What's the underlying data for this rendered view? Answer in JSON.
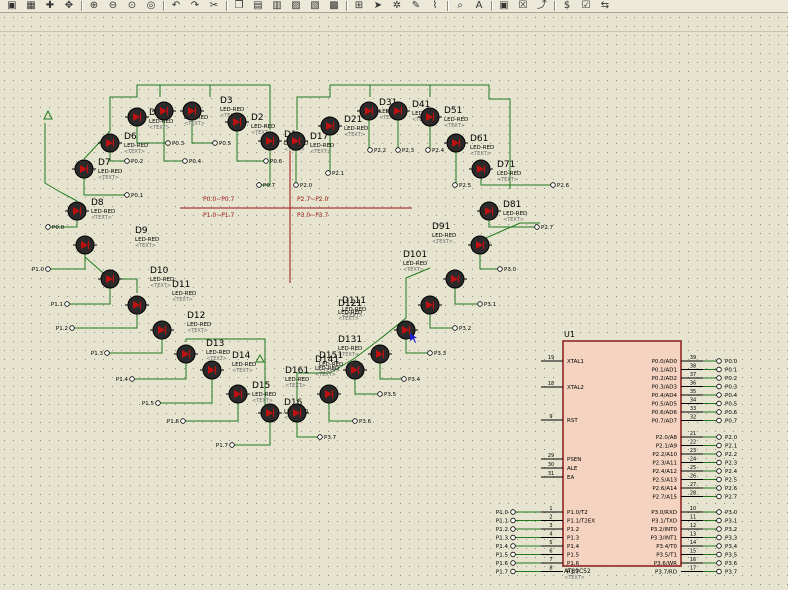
{
  "toolbar": {
    "buttons": [
      {
        "name": "component-mode-icon",
        "glyph": "▣"
      },
      {
        "name": "grid-icon",
        "glyph": "▦"
      },
      {
        "name": "origin-icon",
        "glyph": "✚"
      },
      {
        "name": "pan-icon",
        "glyph": "✥"
      },
      {
        "name": "zoom-in-icon",
        "glyph": "⊕"
      },
      {
        "name": "zoom-out-icon",
        "glyph": "⊖"
      },
      {
        "name": "zoom-all-icon",
        "glyph": "⊙"
      },
      {
        "name": "zoom-area-icon",
        "glyph": "◎"
      },
      {
        "name": "undo-icon",
        "glyph": "↶"
      },
      {
        "name": "redo-icon",
        "glyph": "↷"
      },
      {
        "name": "cut-icon",
        "glyph": "✂"
      },
      {
        "name": "copy-icon",
        "glyph": "❐"
      },
      {
        "name": "paste-icon",
        "glyph": "▤"
      },
      {
        "name": "block-copy-icon",
        "glyph": "▥"
      },
      {
        "name": "block-move-icon",
        "glyph": "▨"
      },
      {
        "name": "block-rotate-icon",
        "glyph": "▧"
      },
      {
        "name": "block-delete-icon",
        "glyph": "▩"
      },
      {
        "name": "pick-device-icon",
        "glyph": "⊞"
      },
      {
        "name": "make-device-icon",
        "glyph": "➤"
      },
      {
        "name": "package-tool-icon",
        "glyph": "✲"
      },
      {
        "name": "decompose-icon",
        "glyph": "✎"
      },
      {
        "name": "wire-autorouter-icon",
        "glyph": "⌇"
      },
      {
        "name": "search-tag-icon",
        "glyph": "⌕"
      },
      {
        "name": "property-tool-icon",
        "glyph": "A"
      },
      {
        "name": "new-sheet-icon",
        "glyph": "▣"
      },
      {
        "name": "remove-sheet-icon",
        "glyph": "☒"
      },
      {
        "name": "exit-to-parent-icon",
        "glyph": "⤴"
      },
      {
        "name": "bom-icon",
        "glyph": "$"
      },
      {
        "name": "erc-icon",
        "glyph": "☑"
      },
      {
        "name": "netlist-icon",
        "glyph": "⇆"
      }
    ]
  },
  "net_labels": {
    "p0": [
      "P0.0",
      "P0.1",
      "P0.2",
      "P0.3",
      "P0.4",
      "P0.5",
      "P0.6",
      "P0.7"
    ],
    "p1": [
      "P1.0",
      "P1.1",
      "P1.2",
      "P1.3",
      "P1.4",
      "P1.5",
      "P1.6",
      "P1.7"
    ],
    "p2": [
      "P2.0",
      "P2.1",
      "P2.2",
      "P2.3",
      "P2.4",
      "P2.5",
      "P2.6",
      "P2.7"
    ],
    "p3": [
      "P3.0",
      "P3.1",
      "P3.2",
      "P3.3",
      "P3.4",
      "P3.5",
      "P3.6",
      "P3.7"
    ]
  },
  "leds": {
    "part_value": "LED-RED",
    "text_placeholder": "<TEXT>",
    "refs": {
      "tl": [
        "D8",
        "D7",
        "D6",
        "D5",
        "D4",
        "D3",
        "D2",
        "D1"
      ],
      "bl": [
        "D9",
        "D10",
        "D11",
        "D12",
        "D13",
        "D14",
        "D15",
        "D16"
      ],
      "tr": [
        "D17",
        "D21",
        "D31",
        "D41",
        "D51",
        "D61",
        "D71",
        "D81"
      ],
      "br": [
        "D91",
        "D101",
        "D111",
        "D121",
        "D131",
        "D141",
        "D151",
        "D161"
      ]
    }
  },
  "quadrant_labels": {
    "tl": "P0.0~P0.7",
    "tr": "P2.7~P2.0",
    "bl": "P1.0~P1.7",
    "br": "P3.0~P3.7"
  },
  "chip": {
    "ref": "U1",
    "part": "AT89C52",
    "text_placeholder": "<TEXT>",
    "left_pins": [
      {
        "num": "19",
        "name": "XTAL1"
      },
      {
        "num": "18",
        "name": "XTAL2"
      },
      {
        "num": "9",
        "name": "RST"
      },
      {
        "num": "29",
        "name": "PSEN"
      },
      {
        "num": "30",
        "name": "ALE"
      },
      {
        "num": "31",
        "name": "EA"
      }
    ],
    "p1_pins": [
      {
        "num": "1",
        "name": "P1.0/T2",
        "net": "P1.0"
      },
      {
        "num": "2",
        "name": "P1.1/T2EX",
        "net": "P1.1"
      },
      {
        "num": "3",
        "name": "P1.2",
        "net": "P1.2"
      },
      {
        "num": "4",
        "name": "P1.3",
        "net": "P1.3"
      },
      {
        "num": "5",
        "name": "P1.4",
        "net": "P1.4"
      },
      {
        "num": "6",
        "name": "P1.5",
        "net": "P1.5"
      },
      {
        "num": "7",
        "name": "P1.6",
        "net": "P1.6"
      },
      {
        "num": "8",
        "name": "P1.7",
        "net": "P1.7"
      }
    ],
    "p0_pins": [
      {
        "num": "39",
        "name": "P0.0/AD0",
        "net": "P0.0"
      },
      {
        "num": "38",
        "name": "P0.1/AD1",
        "net": "P0.1"
      },
      {
        "num": "37",
        "name": "P0.2/AD2",
        "net": "P0.2"
      },
      {
        "num": "36",
        "name": "P0.3/AD3",
        "net": "P0.3"
      },
      {
        "num": "35",
        "name": "P0.4/AD4",
        "net": "P0.4"
      },
      {
        "num": "34",
        "name": "P0.5/AD5",
        "net": "P0.5"
      },
      {
        "num": "33",
        "name": "P0.6/AD6",
        "net": "P0.6"
      },
      {
        "num": "32",
        "name": "P0.7/AD7",
        "net": "P0.7"
      }
    ],
    "p2_pins": [
      {
        "num": "21",
        "name": "P2.0/A8",
        "net": "P2.0"
      },
      {
        "num": "22",
        "name": "P2.1/A9",
        "net": "P2.1"
      },
      {
        "num": "23",
        "name": "P2.2/A10",
        "net": "P2.2"
      },
      {
        "num": "24",
        "name": "P2.3/A11",
        "net": "P2.3"
      },
      {
        "num": "25",
        "name": "P2.4/A12",
        "net": "P2.4"
      },
      {
        "num": "26",
        "name": "P2.5/A13",
        "net": "P2.5"
      },
      {
        "num": "27",
        "name": "P2.6/A14",
        "net": "P2.6"
      },
      {
        "num": "28",
        "name": "P2.7/A15",
        "net": "P2.7"
      }
    ],
    "p3_pins": [
      {
        "num": "10",
        "name": "P3.0/RXD",
        "net": "P3.0"
      },
      {
        "num": "11",
        "name": "P3.1/TXD",
        "net": "P3.1"
      },
      {
        "num": "12",
        "name": "P3.2/INT0",
        "net": "P3.2"
      },
      {
        "num": "13",
        "name": "P3.3/INT1",
        "net": "P3.3"
      },
      {
        "num": "14",
        "name": "P3.4/T0",
        "net": "P3.4"
      },
      {
        "num": "15",
        "name": "P3.5/T1",
        "net": "P3.5"
      },
      {
        "num": "16",
        "name": "P3.6/WR",
        "net": "P3.6"
      },
      {
        "num": "17",
        "name": "P3.7/RD",
        "net": "P3.7"
      }
    ]
  },
  "colors": {
    "sheet": "#e6e4cf",
    "grid_dot": "#8a8a8a",
    "wire": "#1f7a1f",
    "led_body": "#2a2a2a",
    "led_fill": "#c01010",
    "chip_fill": "#f4d3c0",
    "chip_border": "#8b1a1a",
    "quadrant_line": "#9b1010",
    "label": "#000000"
  }
}
